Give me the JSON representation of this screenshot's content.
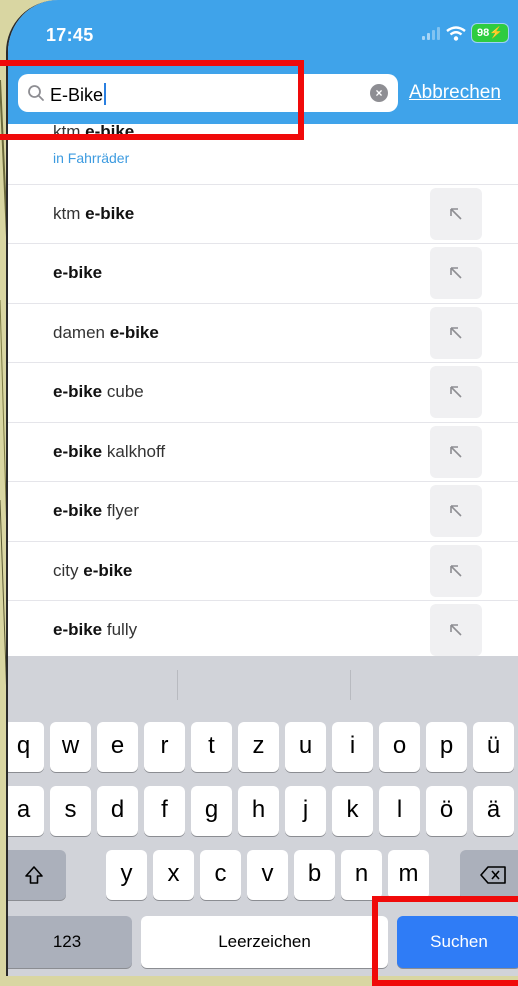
{
  "status_bar": {
    "time": "17:45",
    "battery": "98"
  },
  "search": {
    "value": "E-Bike",
    "cancel_label": "Abbrechen"
  },
  "suggestions": [
    {
      "pre": "ktm ",
      "bold": "e-bike",
      "post": "",
      "sub": "in Fahrräder",
      "fill_button": false
    },
    {
      "pre": "ktm ",
      "bold": "e-bike",
      "post": "",
      "sub": "",
      "fill_button": true
    },
    {
      "pre": "",
      "bold": "e-bike",
      "post": "",
      "sub": "",
      "fill_button": true
    },
    {
      "pre": "damen ",
      "bold": "e-bike",
      "post": "",
      "sub": "",
      "fill_button": true
    },
    {
      "pre": "",
      "bold": "e-bike",
      "post": " cube",
      "sub": "",
      "fill_button": true
    },
    {
      "pre": "",
      "bold": "e-bike",
      "post": " kalkhoff",
      "sub": "",
      "fill_button": true
    },
    {
      "pre": "",
      "bold": "e-bike",
      "post": " flyer",
      "sub": "",
      "fill_button": true
    },
    {
      "pre": "city ",
      "bold": "e-bike",
      "post": "",
      "sub": "",
      "fill_button": true
    },
    {
      "pre": "",
      "bold": "e-bike",
      "post": " fully",
      "sub": "",
      "fill_button": true
    }
  ],
  "keyboard": {
    "row1": [
      "q",
      "w",
      "e",
      "r",
      "t",
      "z",
      "u",
      "i",
      "o",
      "p",
      "ü"
    ],
    "row2": [
      "a",
      "s",
      "d",
      "f",
      "g",
      "h",
      "j",
      "k",
      "l",
      "ö",
      "ä"
    ],
    "row3": [
      "y",
      "x",
      "c",
      "v",
      "b",
      "n",
      "m"
    ],
    "numbers_label": "123",
    "space_label": "Leerzeichen",
    "search_label": "Suchen"
  },
  "colors": {
    "header": "#3fa3ea",
    "highlight": "#f00a0a",
    "search_key": "#2f7cf6",
    "sub_link": "#3d9be0"
  }
}
